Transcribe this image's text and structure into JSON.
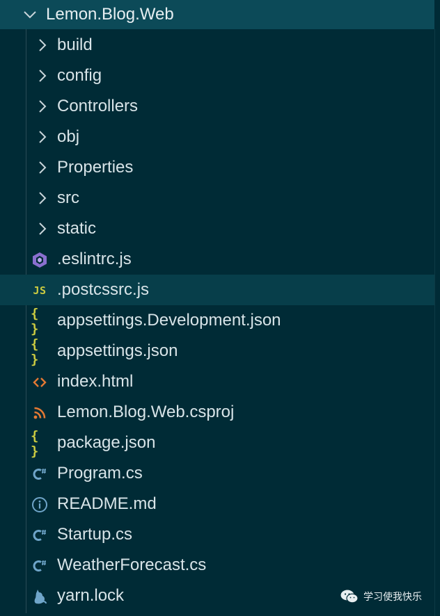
{
  "explorer": {
    "root_folder": "Lemon.Blog.Web",
    "folders": [
      {
        "label": "build"
      },
      {
        "label": "config"
      },
      {
        "label": "Controllers"
      },
      {
        "label": "obj"
      },
      {
        "label": "Properties"
      },
      {
        "label": "src"
      },
      {
        "label": "static"
      }
    ],
    "files": [
      {
        "label": ".eslintrc.js",
        "icon": "eslint-icon",
        "glyph": ""
      },
      {
        "label": ".postcssrc.js",
        "icon": "javascript-icon",
        "glyph": "JS",
        "selected": true
      },
      {
        "label": "appsettings.Development.json",
        "icon": "json-icon",
        "glyph": "{ }"
      },
      {
        "label": "appsettings.json",
        "icon": "json-icon",
        "glyph": "{ }"
      },
      {
        "label": "index.html",
        "icon": "html-icon",
        "glyph": "<>"
      },
      {
        "label": "Lemon.Blog.Web.csproj",
        "icon": "rss-icon",
        "glyph": ""
      },
      {
        "label": "package.json",
        "icon": "json-icon",
        "glyph": "{ }"
      },
      {
        "label": "Program.cs",
        "icon": "csharp-icon",
        "glyph": "C#"
      },
      {
        "label": "README.md",
        "icon": "info-icon",
        "glyph": "i"
      },
      {
        "label": "Startup.cs",
        "icon": "csharp-icon",
        "glyph": "C#"
      },
      {
        "label": "WeatherForecast.cs",
        "icon": "csharp-icon",
        "glyph": "C#"
      },
      {
        "label": "yarn.lock",
        "icon": "yarn-cat-icon",
        "glyph": ""
      }
    ]
  },
  "watermark": {
    "text": "学习使我快乐",
    "icon": "wechat-icon"
  },
  "colors": {
    "background": "#002b36",
    "root_highlight": "#0c4a58",
    "selected_row": "#073e4a",
    "json_yellow": "#cbcb41",
    "csharp_blue": "#6fa5c9",
    "eslint_purple": "#8a6fcf",
    "html_orange": "#e37933",
    "rss_orange": "#e37933",
    "info_blue": "#6fa5c9"
  }
}
